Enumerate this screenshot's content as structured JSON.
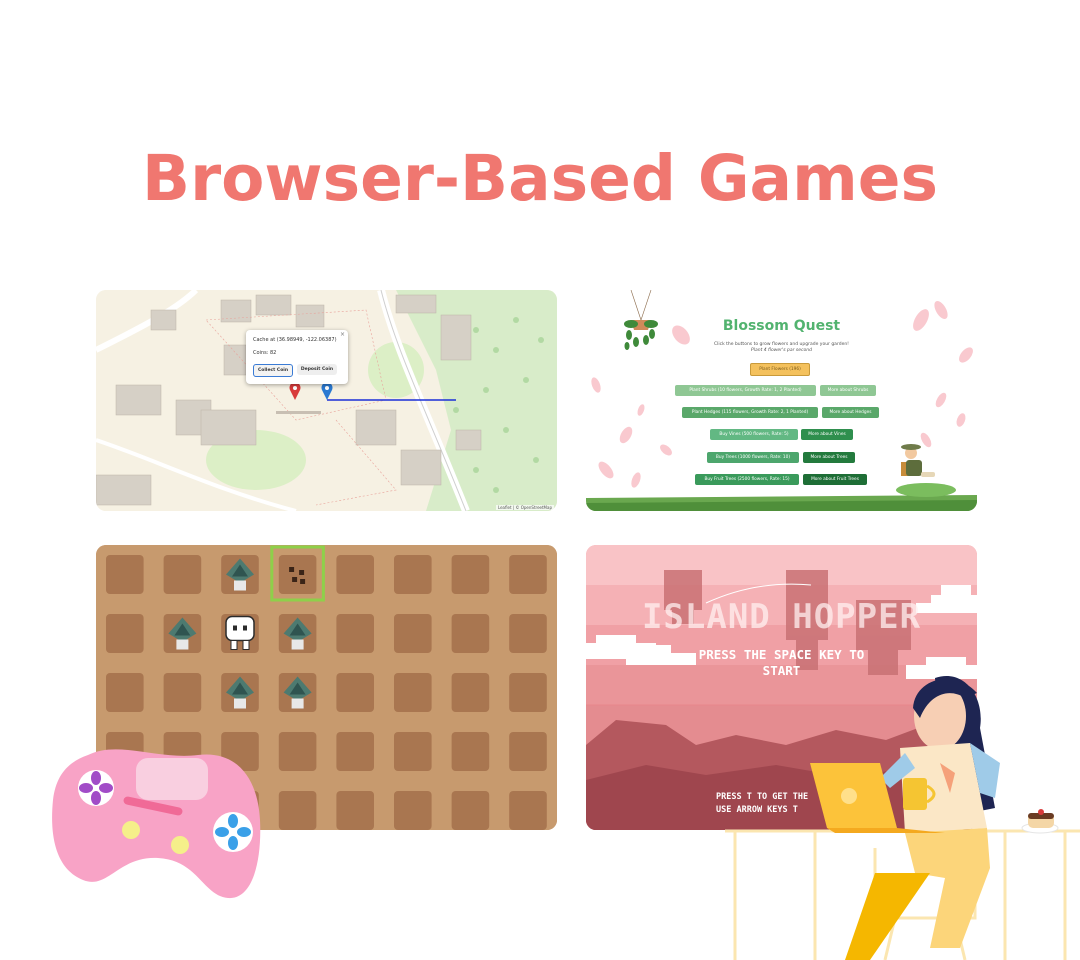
{
  "page": {
    "title": "Browser-Based Games"
  },
  "map_game": {
    "popup": {
      "cache_label": "Cache at (36.98949, -122.06387)",
      "coins_label": "Coins: 82",
      "close": "×",
      "collect_button": "Collect Coin",
      "deposit_button": "Deposit Coin"
    },
    "attribution": "Leaflet | © OpenStreetMap"
  },
  "blossom_quest": {
    "title": "Blossom Quest",
    "subtitle_line1": "Click the buttons to grow flowers and upgrade your garden!",
    "subtitle_line2": "Plant 4 flower's par second",
    "buttons": [
      {
        "label": "Plant Flowers (196)",
        "color": "#f4c15d"
      },
      {
        "label": "Plant Shrubs (10 flowers, Growth Rate: 1, 2 Planted)",
        "color": "#8fc794"
      },
      {
        "label": "More about Shrubs",
        "color": "#8fc794"
      },
      {
        "label": "Plant Hedges (115 flowers, Growth Rate: 2, 1 Planted)",
        "color": "#5aa86a"
      },
      {
        "label": "More about Hedges",
        "color": "#5aa86a"
      },
      {
        "label": "Buy Vines (500 flowers, Rate: 5)",
        "color": "#62b883"
      },
      {
        "label": "More about Vines",
        "color": "#2f8f4e"
      },
      {
        "label": "Buy Trees (1000 flowers, Rate: 10)",
        "color": "#4da66d"
      },
      {
        "label": "More about Trees",
        "color": "#237a3d"
      },
      {
        "label": "Buy Fruit Trees (2500 flowers, Rate: 15)",
        "color": "#3a9a5b"
      },
      {
        "label": "More about Fruit Trees",
        "color": "#1e6e36"
      }
    ]
  },
  "island_hopper": {
    "title": "ISLAND HOPPER",
    "start_line1": "PRESS THE SPACE KEY TO",
    "start_line2": "START",
    "help_line1": "PRESS T TO GET THE",
    "help_line2": "USE ARROW KEYS T"
  },
  "colors": {
    "title": "#f07770",
    "soil": "#c79a6e",
    "tile": "#a97650",
    "highlight": "#8ed04a"
  }
}
